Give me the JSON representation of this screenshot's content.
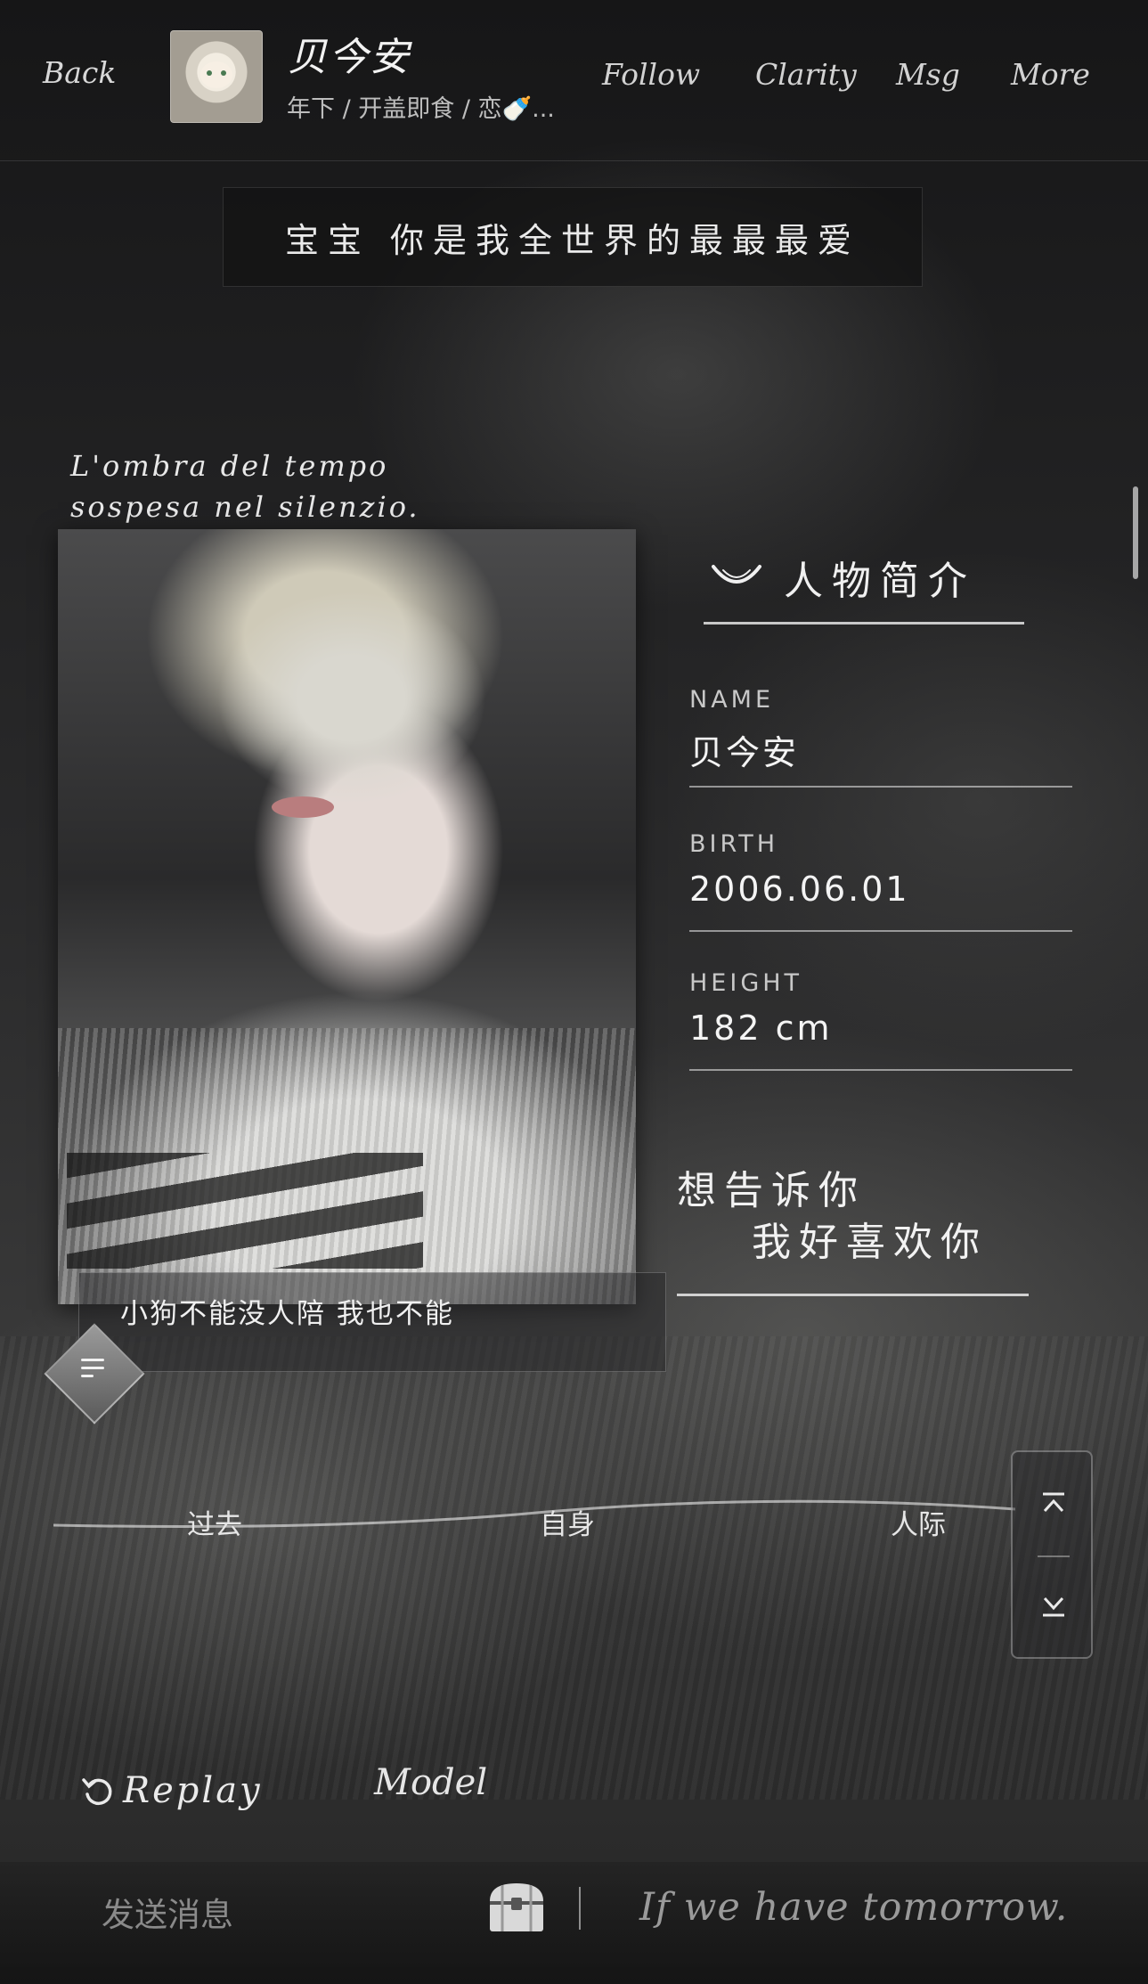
{
  "header": {
    "back_label": "Back",
    "character_name": "贝今安",
    "character_tags": "年下 / 开盖即食 / 恋🍼...",
    "follow_label": "Follow",
    "clarity_label": "Clarity",
    "msg_label": "Msg",
    "more_label": "More"
  },
  "banner": {
    "text": "宝宝 你是我全世界的最最最爱"
  },
  "quote": {
    "line1": "L'ombra del tempo",
    "line2": "sospesa nel silenzio."
  },
  "portrait": {
    "caption": "小狗不能没人陪 我也不能"
  },
  "profile": {
    "section_title": "人物简介",
    "fields": [
      {
        "label": "NAME",
        "value": "贝今安"
      },
      {
        "label": "BIRTH",
        "value": "2006.06.01"
      },
      {
        "label": "HEIGHT",
        "value": "182 cm"
      }
    ],
    "confession_line1": "想告诉你",
    "confession_line2": "我好喜欢你"
  },
  "tabs": [
    {
      "label": "过去"
    },
    {
      "label": "自身"
    },
    {
      "label": "人际"
    }
  ],
  "footer": {
    "replay_label": "Replay",
    "model_label": "Model",
    "message_placeholder": "发送消息",
    "tagline": "If we have tomorrow."
  },
  "icons": {
    "menu": "menu-lines-icon",
    "smile": "smile-curve-icon",
    "chevron_up": "chevron-up-icon",
    "chevron_down": "chevron-down-icon",
    "replay": "replay-icon",
    "chest": "treasure-chest-icon"
  },
  "colors": {
    "accent": "#f0f0f0",
    "muted": "#8a8a8a",
    "background": "#1b1b1c"
  }
}
